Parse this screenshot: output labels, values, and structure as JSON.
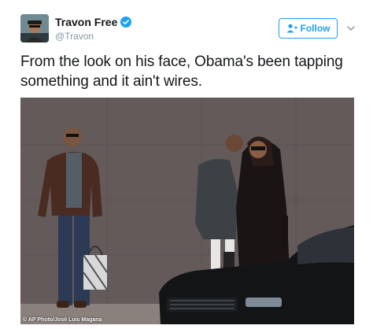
{
  "tweet": {
    "display_name": "Travon Free",
    "handle": "@Travon",
    "verified": true,
    "follow_label": "Follow",
    "text": "From the look on his face, Obama's been tapping something and it ain't wires.",
    "photo_credit": "© AP Photo/José Luis Magana"
  },
  "icons": {
    "verified": "verified-badge-icon",
    "follow": "add-user-icon",
    "more": "chevron-down-icon"
  },
  "colors": {
    "accent": "#1da1f2",
    "text": "#14171a",
    "muted": "#8899a6"
  }
}
